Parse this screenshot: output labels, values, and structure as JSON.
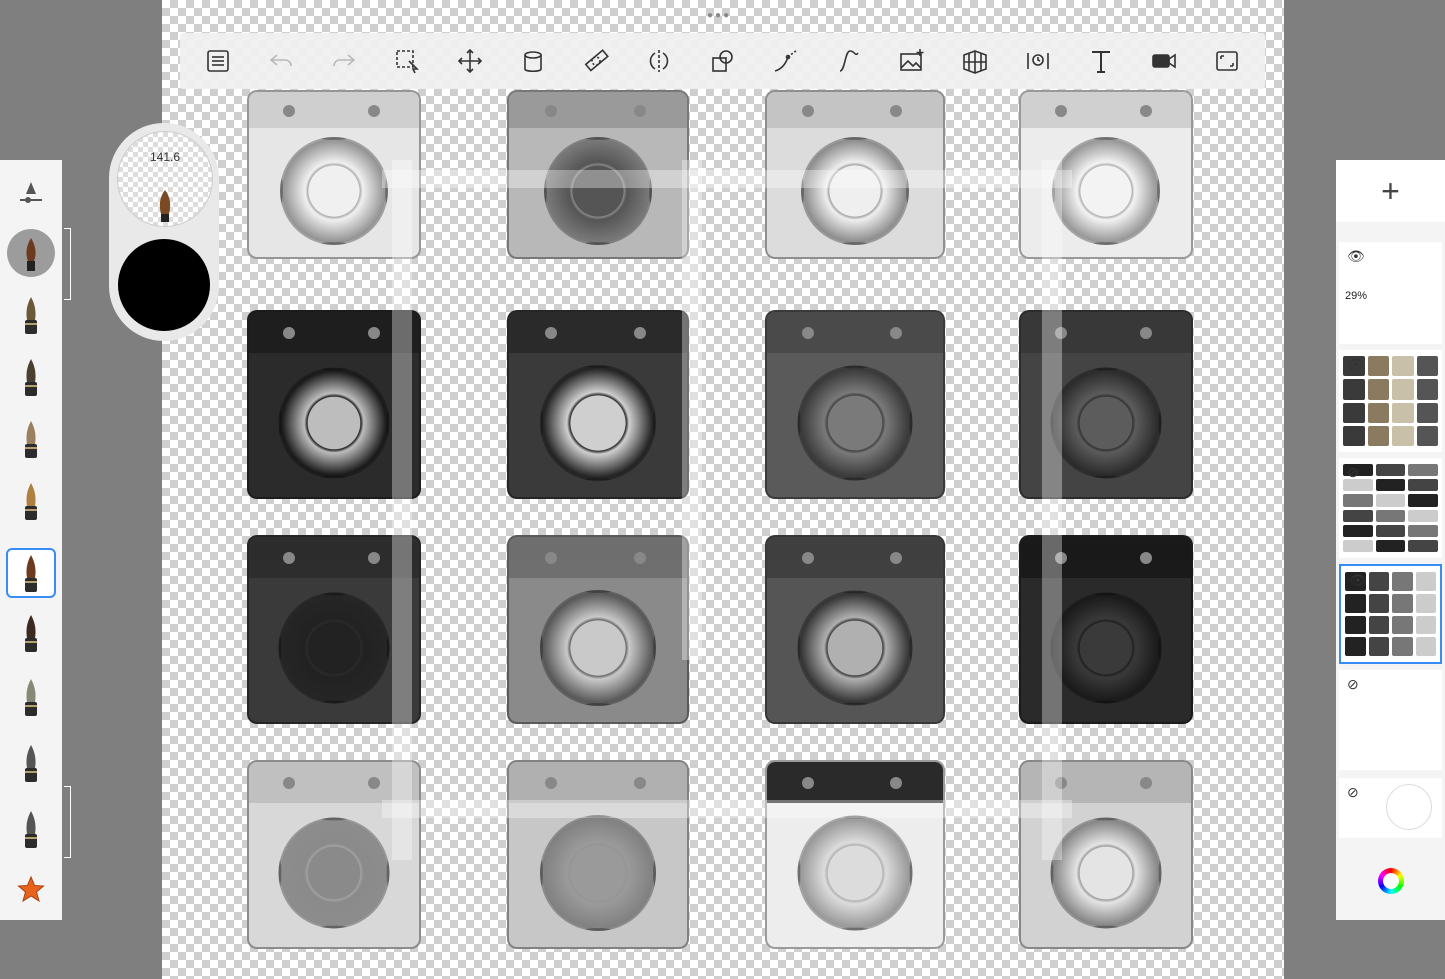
{
  "toolbar": {
    "tools": [
      {
        "name": "layer-list-icon",
        "tone": "normal"
      },
      {
        "name": "undo-icon",
        "tone": "dim"
      },
      {
        "name": "redo-icon",
        "tone": "dim"
      },
      {
        "name": "selection-icon",
        "tone": "normal"
      },
      {
        "name": "transform-icon",
        "tone": "normal"
      },
      {
        "name": "fill-bucket-icon",
        "tone": "normal"
      },
      {
        "name": "ruler-icon",
        "tone": "normal"
      },
      {
        "name": "symmetry-icon",
        "tone": "normal"
      },
      {
        "name": "shapes-icon",
        "tone": "normal"
      },
      {
        "name": "guides-icon",
        "tone": "normal"
      },
      {
        "name": "curve-icon",
        "tone": "normal"
      },
      {
        "name": "import-image-icon",
        "tone": "normal"
      },
      {
        "name": "perspective-grid-icon",
        "tone": "normal"
      },
      {
        "name": "time-lapse-icon",
        "tone": "normal"
      },
      {
        "name": "text-icon",
        "tone": "normal"
      },
      {
        "name": "record-video-icon",
        "tone": "normal"
      },
      {
        "name": "fullscreen-icon",
        "tone": "normal"
      }
    ]
  },
  "brush_puck": {
    "size_label": "141.6",
    "color": "#000000"
  },
  "brushes": [
    {
      "name": "brush-settings-icon",
      "tone": "#555555"
    },
    {
      "name": "paint-brush-icon",
      "tone": "#6b3a1f"
    },
    {
      "name": "airbrush-icon",
      "tone": "#6b5a3a"
    },
    {
      "name": "marker-icon",
      "tone": "#4a4030"
    },
    {
      "name": "pencil-icon",
      "tone": "#9a8060"
    },
    {
      "name": "fountain-pen-icon",
      "tone": "#b08040"
    },
    {
      "name": "round-brush-icon",
      "tone": "#6b3a1f"
    },
    {
      "name": "ink-pen-icon",
      "tone": "#3a2a20"
    },
    {
      "name": "chalk-icon",
      "tone": "#888877"
    },
    {
      "name": "eraser-soft-icon",
      "tone": "#555555"
    },
    {
      "name": "eraser-hard-icon",
      "tone": "#555555"
    },
    {
      "name": "favorite-star-icon",
      "tone": "#e8641e"
    }
  ],
  "selected_brush_index": 6,
  "layers": {
    "add_label": "+",
    "items": [
      {
        "name": "layer-1",
        "opacity": "29%",
        "visible": true,
        "selected": false
      },
      {
        "name": "layer-2",
        "opacity": "",
        "visible": true,
        "selected": false
      },
      {
        "name": "layer-3",
        "opacity": "",
        "visible": false,
        "selected": false
      },
      {
        "name": "layer-4",
        "opacity": "",
        "visible": true,
        "selected": true
      },
      {
        "name": "layer-5",
        "opacity": "",
        "visible": false,
        "selected": false
      },
      {
        "name": "layer-6",
        "opacity": "",
        "visible": false,
        "selected": false
      }
    ]
  },
  "colors": {
    "accent": "#3a8cf5",
    "star": "#e8641e"
  },
  "washers": [
    {
      "style": "light-top",
      "body": "#e6e6e6",
      "panel": "#cfcfcf",
      "drum": "#f0f0f0"
    },
    {
      "style": "mid-front",
      "body": "#b8b8b8",
      "panel": "#9a9a9a",
      "drum": "#555555"
    },
    {
      "style": "light-drum",
      "body": "#dcdcdc",
      "panel": "#c4c4c4",
      "drum": "#efefef"
    },
    {
      "style": "light-top",
      "body": "#ececec",
      "panel": "#d0d0d0",
      "drum": "#f3f3f3"
    },
    {
      "style": "dark-window",
      "body": "#2b2b2b",
      "panel": "#1e1e1e",
      "drum": "#bdbdbd"
    },
    {
      "style": "dark-drum",
      "body": "#3a3a3a",
      "panel": "#2a2a2a",
      "drum": "#cfcfcf"
    },
    {
      "style": "grey-ring",
      "body": "#5a5a5a",
      "panel": "#4a4a4a",
      "drum": "#7a7a7a"
    },
    {
      "style": "dark-front",
      "body": "#444444",
      "panel": "#383838",
      "drum": "#5c5c5c"
    },
    {
      "style": "dark-open",
      "body": "#3a3a3a",
      "panel": "#2d2d2d",
      "drum": "#222222"
    },
    {
      "style": "grey-open",
      "body": "#8a8a8a",
      "panel": "#6f6f6f",
      "drum": "#c9c9c9"
    },
    {
      "style": "dark-open",
      "body": "#555555",
      "panel": "#404040",
      "drum": "#b0b0b0"
    },
    {
      "style": "black-open",
      "body": "#2a2a2a",
      "panel": "#1a1a1a",
      "drum": "#3a3a3a"
    },
    {
      "style": "light-open",
      "body": "#d8d8d8",
      "panel": "#c0c0c0",
      "drum": "#8a8a8a"
    },
    {
      "style": "light-open",
      "body": "#c7c7c7",
      "panel": "#b0b0b0",
      "drum": "#9a9a9a"
    },
    {
      "style": "white-top",
      "body": "#ededed",
      "panel": "#2a2a2a",
      "drum": "#dcdcdc"
    },
    {
      "style": "light-top",
      "body": "#d2d2d2",
      "panel": "#b5b5b5",
      "drum": "#e4e4e4"
    }
  ]
}
